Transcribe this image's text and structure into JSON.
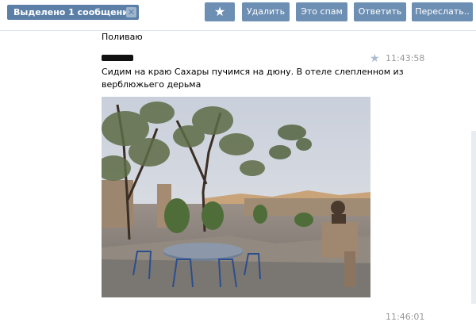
{
  "toolbar": {
    "selected_label": "Выделено 1 сообщение",
    "close_glyph": "✕",
    "star_glyph": "★",
    "delete_label": "Удалить",
    "spam_label": "Это спам",
    "reply_label": "Ответить",
    "forward_label": "Переслать.."
  },
  "messages": {
    "prev_text": "Поливаю",
    "current": {
      "time": "11:43:58",
      "star_glyph": "★",
      "text_line1": "Сидим на краю Сахары пучимся на дюну. В отеле слепленном из",
      "text_line2": "верблюжьего дерьма"
    },
    "next_time": "11:46:01"
  },
  "colors": {
    "button_bg": "#6d8fb3",
    "badge_bg": "#5b7fa6",
    "timestamp": "#999999"
  }
}
